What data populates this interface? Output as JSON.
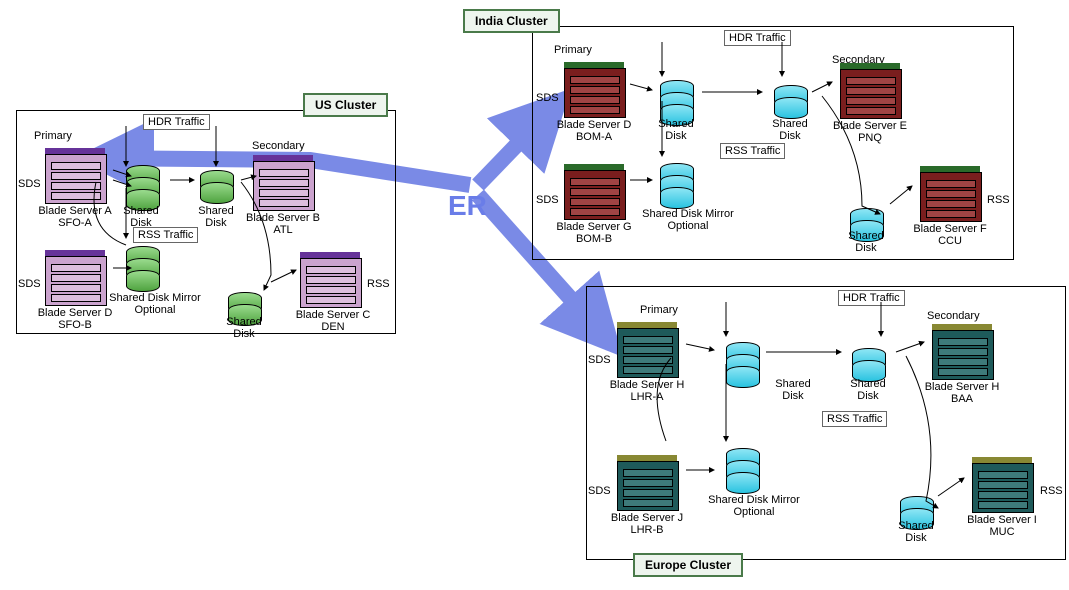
{
  "er_label": "ER",
  "hdr_label": "HDR Traffic",
  "rss_label": "RSS Traffic",
  "primary_label": "Primary",
  "secondary_label": "Secondary",
  "sds_label": "SDS",
  "rss_tag": "RSS",
  "shared_disk": "Shared Disk",
  "mirror": "Shared Disk Mirror Optional",
  "clusters": {
    "us": {
      "title": "US Cluster",
      "servers": {
        "a": "Blade Server A SFO-A",
        "b": "Blade Server B ATL",
        "c": "Blade Server C DEN",
        "d": "Blade Server D SFO-B"
      }
    },
    "india": {
      "title": "India Cluster",
      "servers": {
        "d": "Blade Server D BOM-A",
        "e": "Blade Server E PNQ",
        "f": "Blade Server F CCU",
        "g": "Blade Server G BOM-B"
      }
    },
    "europe": {
      "title": "Europe Cluster",
      "servers": {
        "h": "Blade Server H LHR-A",
        "h2": "Blade Server H BAA",
        "i": "Blade Server I MUC",
        "j": "Blade Server J LHR-B"
      }
    }
  }
}
